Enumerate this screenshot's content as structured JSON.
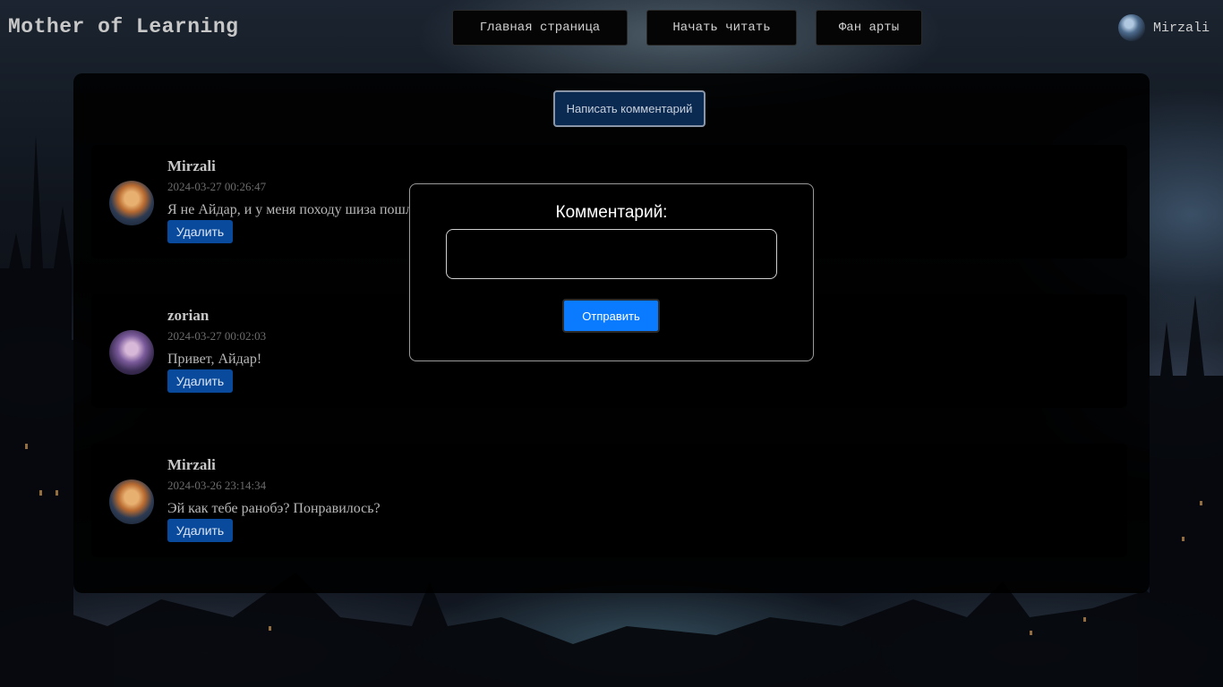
{
  "header": {
    "site_title": "Mother of Learning",
    "nav": {
      "home": "Главная страница",
      "read": "Начать читать",
      "fanart": "Фан арты"
    },
    "user_name": "Mirzali"
  },
  "write_comment_label": "Написать комментарий",
  "comments": [
    {
      "author": "Mirzali",
      "date": "2024-03-27 00:26:47",
      "text": "Я не Айдар, и у меня походу шиза пошла",
      "delete_label": "Удалить"
    },
    {
      "author": "zorian",
      "date": "2024-03-27 00:02:03",
      "text": "Привет, Айдар!",
      "delete_label": "Удалить"
    },
    {
      "author": "Mirzali",
      "date": "2024-03-26 23:14:34",
      "text": "Эй как тебе ранобэ? Понравилось?",
      "delete_label": "Удалить"
    }
  ],
  "modal": {
    "title": "Комментарий:",
    "input_value": "",
    "submit_label": "Отправить"
  },
  "icons": {
    "user_avatar": "user-avatar-icon",
    "comment_avatar": "avatar"
  },
  "colors": {
    "delete_button": "#0a4a9c",
    "submit_button": "#0a7bff",
    "write_button": "#0b2a52"
  }
}
